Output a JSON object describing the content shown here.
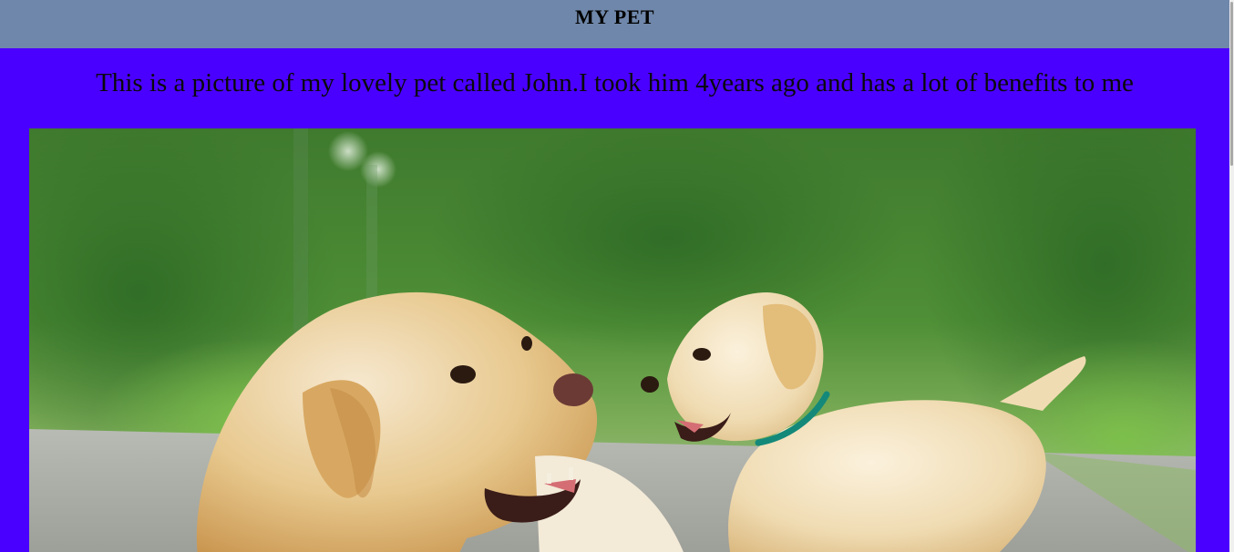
{
  "header": {
    "title": "MY PET",
    "background": "#6f87aa"
  },
  "main": {
    "background": "#4a00ff",
    "caption": "This is a picture of my lovely pet called John.I took him 4years ago and has a lot of benefits to me",
    "image_subject": "adult-labrador-and-puppy"
  }
}
